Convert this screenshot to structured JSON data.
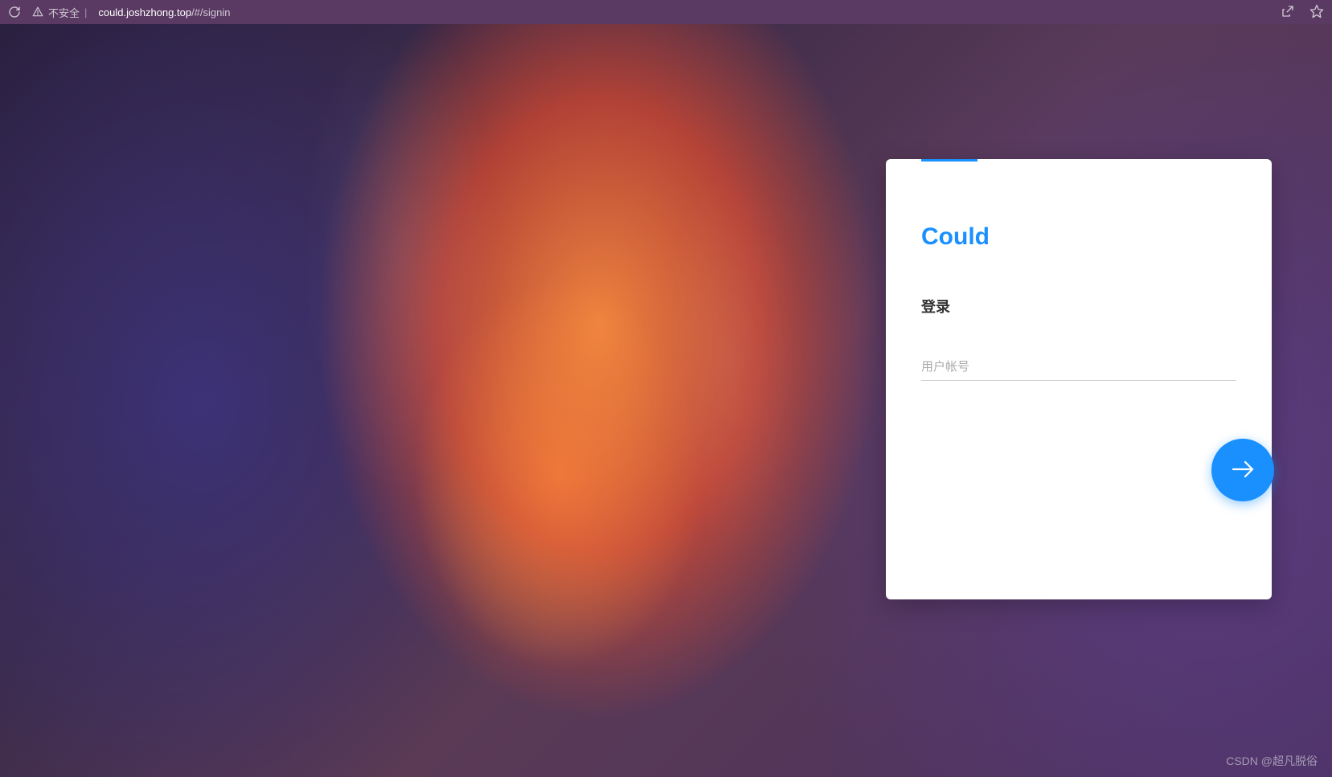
{
  "browser": {
    "insecure_label": "不安全",
    "url_domain": "could.joshzhong.top",
    "url_path": "/#/signin"
  },
  "login": {
    "brand": "Could",
    "title": "登录",
    "username_placeholder": "用户帐号"
  },
  "watermark": "CSDN @超凡脱俗"
}
